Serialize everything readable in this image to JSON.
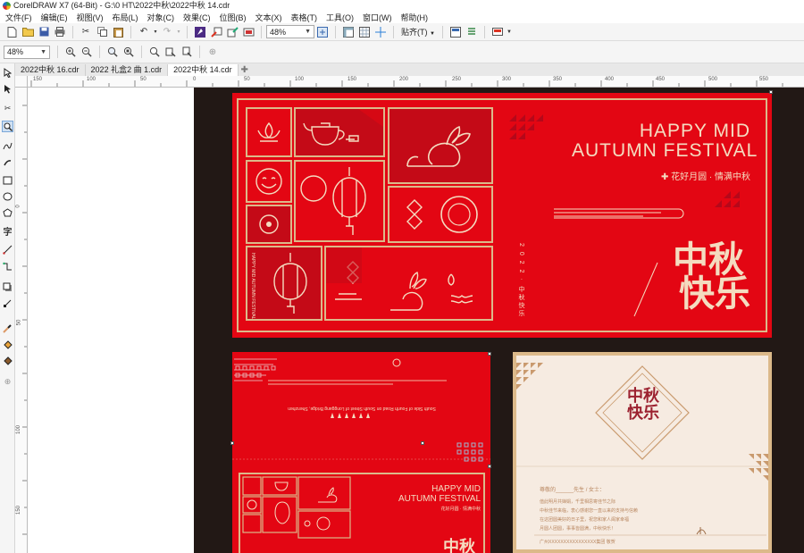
{
  "window": {
    "title": "CorelDRAW X7 (64-Bit) - G:\\0 HT\\2022中秋\\2022中秋 14.cdr"
  },
  "menu": [
    "文件(F)",
    "编辑(E)",
    "视图(V)",
    "布局(L)",
    "对象(C)",
    "效果(C)",
    "位图(B)",
    "文本(X)",
    "表格(T)",
    "工具(O)",
    "窗口(W)",
    "帮助(H)"
  ],
  "toolbar": {
    "zoom_value": "48%",
    "snap_label": "贴齐(T)"
  },
  "propbar": {
    "zoom_value": "48%"
  },
  "tabs": [
    {
      "label": "2022中秋 16.cdr",
      "active": false
    },
    {
      "label": "2022 礼盒2 曲 1.cdr",
      "active": false
    },
    {
      "label": "2022中秋 14.cdr",
      "active": true
    }
  ],
  "ruler": {
    "h_labels": [
      "150",
      "100",
      "50",
      "0",
      "50",
      "100",
      "150",
      "200",
      "250",
      "300",
      "350",
      "400",
      "450",
      "500",
      "550",
      "600"
    ],
    "v_labels": [
      "0",
      "50",
      "100",
      "150"
    ]
  },
  "artwork": {
    "card1": {
      "title_line1": "HAPPY MID",
      "title_line2": "AUTUMN FESTIVAL",
      "subtitle": "✚ 花好月圆 · 情满中秋",
      "year_vertical": "2 0 2 2 · 中秋快乐",
      "zhongqiu": "中秋",
      "kuaile": "快乐",
      "side_vertical": "HAPPY MID AUTUMN FESTIVAL"
    },
    "card2": {
      "address": "South Side of Fourth Road on South Street of Longgang Bridge, Shenzhen",
      "title_line1": "HAPPY MID",
      "title_line2": "AUTUMN FESTIVAL",
      "subtitle": "花好月圆 · 情满中秋",
      "zhongqiu": "中秋"
    },
    "card3": {
      "emblem_line1": "中秋",
      "emblem_line2": "快乐",
      "greeting": "尊敬的______先生 / 女士：",
      "body": [
        "值此明月共婵娟，千里相思寄佳节之际",
        "中秋佳节来临，衷心感谢您一直以来的支持与信赖",
        "在这团圆美好的日子里，祝您和家人阖家幸福",
        "月圆人团圆，事事皆圆满，中秋快乐！"
      ],
      "signature": "广州XXXXXXXXXXXXXXXX集团 敬贺"
    }
  },
  "colors": {
    "card_red": "#e30613",
    "gold": "#dcb98a",
    "dark_bg": "#221815",
    "paper": "#f6ebe1"
  }
}
